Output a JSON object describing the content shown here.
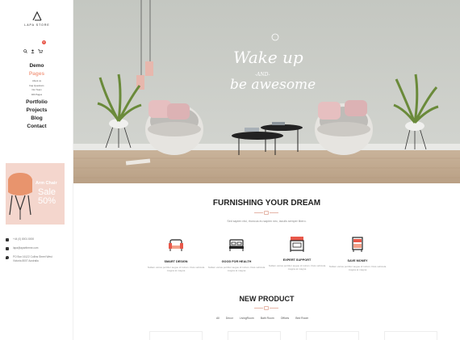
{
  "brand": {
    "name": "LAPA STORE"
  },
  "util_icons": [
    "search-icon",
    "user-icon",
    "cart-icon"
  ],
  "cart_count": "0",
  "nav": {
    "items": [
      {
        "label": "Demo",
        "active": false
      },
      {
        "label": "Pages",
        "active": true
      },
      {
        "label": "Portfolio",
        "active": false
      },
      {
        "label": "Projects",
        "active": false
      },
      {
        "label": "Blog",
        "active": false
      },
      {
        "label": "Contact",
        "active": false
      }
    ],
    "pages_sub": [
      "About us",
      "Faq Questions",
      "Our Team",
      "404 Pages"
    ]
  },
  "promo": {
    "title": "Arm Chair",
    "sale": "Sale",
    "percent": "50%"
  },
  "contact": {
    "phone": "+44 (0) 8001 8000",
    "email": "lapa@apartheme.com",
    "address": "PO Box 16122 Collins Street West Victoria 8007 Australia"
  },
  "hero": {
    "wall_text_1": "Wake up",
    "wall_text_2": "-AND-",
    "wall_text_3": "be awesome"
  },
  "furnishing": {
    "title": "FURNISHING YOUR DREAM",
    "subtitle": "Sed sapien nisi, rhoncus eu sapien nec, iaculis semper libero.",
    "features": [
      {
        "title": "SMART DESIGN",
        "desc": "Nullam varius porttitor augue id rutrum. Duis vehicula magna at magna",
        "icon": "armchair-icon"
      },
      {
        "title": "GOOD FOR HEALTH",
        "desc": "Nullam varius porttitor augue id rutrum. Duis vehicula magna at magna",
        "icon": "bed-icon"
      },
      {
        "title": "EXPERT SUPPORT",
        "desc": "Nullam varius porttitor augue id rutrum. Duis vehicula magna at magna",
        "icon": "cabinet-icon"
      },
      {
        "title": "SAVE MONEY",
        "desc": "Nullam varius porttitor augue id rutrum. Duis vehicula magna at magna",
        "icon": "drawer-icon"
      }
    ]
  },
  "new_product": {
    "title": "NEW PRODUCT",
    "categories": [
      "All",
      "Decor",
      "LivingRoom",
      "Bath Room",
      "Offices",
      "Bed Room"
    ]
  },
  "colors": {
    "accent": "#f3a18a",
    "promo_bg": "#f4d6cd",
    "hero_wall": "#c9ccc6"
  }
}
